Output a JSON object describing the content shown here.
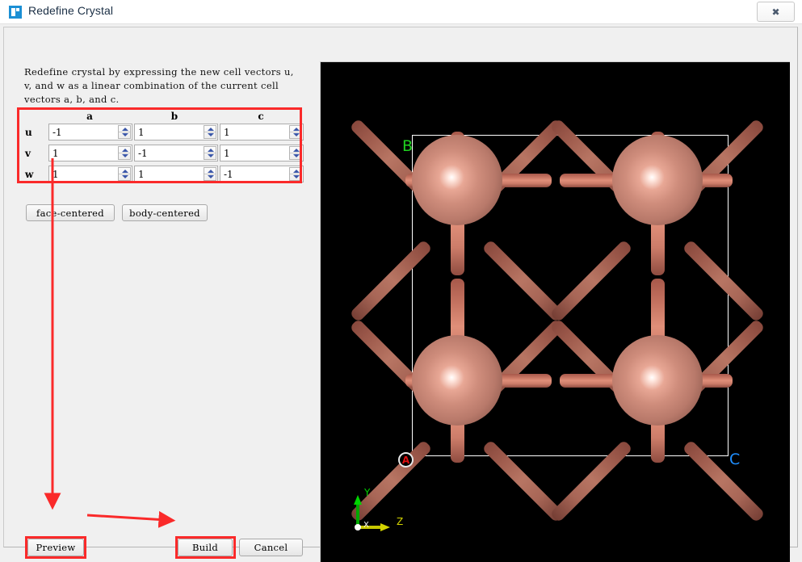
{
  "window": {
    "title": "Redefine Crystal",
    "icon": "app-icon",
    "close_label": "✖"
  },
  "panel": {
    "description": "Redefine crystal by expressing the new  cell vectors u,\nv,  and w as a linear combination of the current cell\nvectors a,  b,  and c."
  },
  "matrix": {
    "column_headers": [
      "a",
      "b",
      "c"
    ],
    "row_labels": [
      "u",
      "v",
      "w"
    ],
    "rows": [
      {
        "label": "u",
        "a": "-1",
        "b": "1",
        "c": "1"
      },
      {
        "label": "v",
        "a": "1",
        "b": "-1",
        "c": "1"
      },
      {
        "label": "w",
        "a": "1",
        "b": "1",
        "c": "-1"
      }
    ],
    "highlight_color": "#fa2a2a"
  },
  "preset_buttons": {
    "face_centered": "face-centered",
    "body_centered": "body-centered"
  },
  "actions": {
    "preview": "Preview",
    "build": "Build",
    "cancel": "Cancel"
  },
  "viewport": {
    "background": "#000000",
    "axis_labels": {
      "b": "B",
      "c": "C",
      "origin": "A"
    },
    "gizmo": {
      "y": "Y",
      "z": "Z",
      "x": "X"
    },
    "gizmo_colors": {
      "y": "#00d400",
      "z": "#d4d400",
      "x": "#ffffff"
    },
    "atom_color": "#cf8d7c",
    "bond_color": "#d8846f",
    "cell_border": "#ffffff",
    "atom_count": 4
  }
}
